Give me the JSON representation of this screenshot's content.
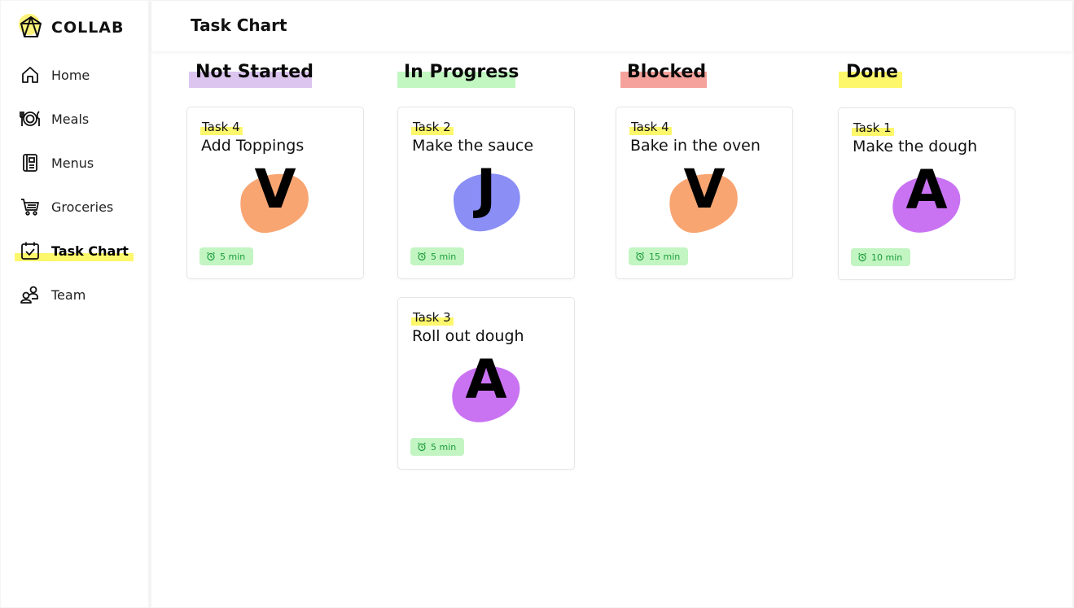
{
  "app": {
    "name": "COLLAB"
  },
  "page": {
    "title": "Task Chart"
  },
  "sidebar": {
    "items": [
      {
        "label": "Home",
        "icon": "home-icon"
      },
      {
        "label": "Meals",
        "icon": "plate-cutlery-icon"
      },
      {
        "label": "Menus",
        "icon": "menu-book-icon"
      },
      {
        "label": "Groceries",
        "icon": "cart-icon"
      },
      {
        "label": "Task Chart",
        "icon": "calendar-check-icon",
        "active": true
      },
      {
        "label": "Team",
        "icon": "team-icon"
      }
    ]
  },
  "colors": {
    "highlight": "#fdf76c",
    "not_started": "#dcc5ef",
    "in_progress": "#c2f7c2",
    "blocked": "#f5a29c",
    "done": "#fdf76c",
    "badge_bg": "#c2f5c2",
    "badge_text": "#1d9c3a"
  },
  "board": {
    "columns": [
      {
        "title": "Not Started",
        "cards": [
          {
            "task": "Task 4",
            "title": "Add Toppings",
            "initial": "V",
            "avatar_color": "#f8a572",
            "time": "5 min"
          }
        ]
      },
      {
        "title": "In Progress",
        "cards": [
          {
            "task": "Task 2",
            "title": "Make the sauce",
            "initial": "J",
            "avatar_color": "#8a8ef5",
            "time": "5 min"
          },
          {
            "task": "Task 3",
            "title": "Roll out dough",
            "initial": "A",
            "avatar_color": "#c973f3",
            "time": "5 min"
          }
        ]
      },
      {
        "title": "Blocked",
        "cards": [
          {
            "task": "Task 4",
            "title": "Bake in the oven",
            "initial": "V",
            "avatar_color": "#f8a572",
            "time": "15 min"
          }
        ]
      },
      {
        "title": "Done",
        "cards": [
          {
            "task": "Task 1",
            "title": "Make the dough",
            "initial": "A",
            "avatar_color": "#c973f3",
            "time": "10 min"
          }
        ]
      }
    ]
  }
}
